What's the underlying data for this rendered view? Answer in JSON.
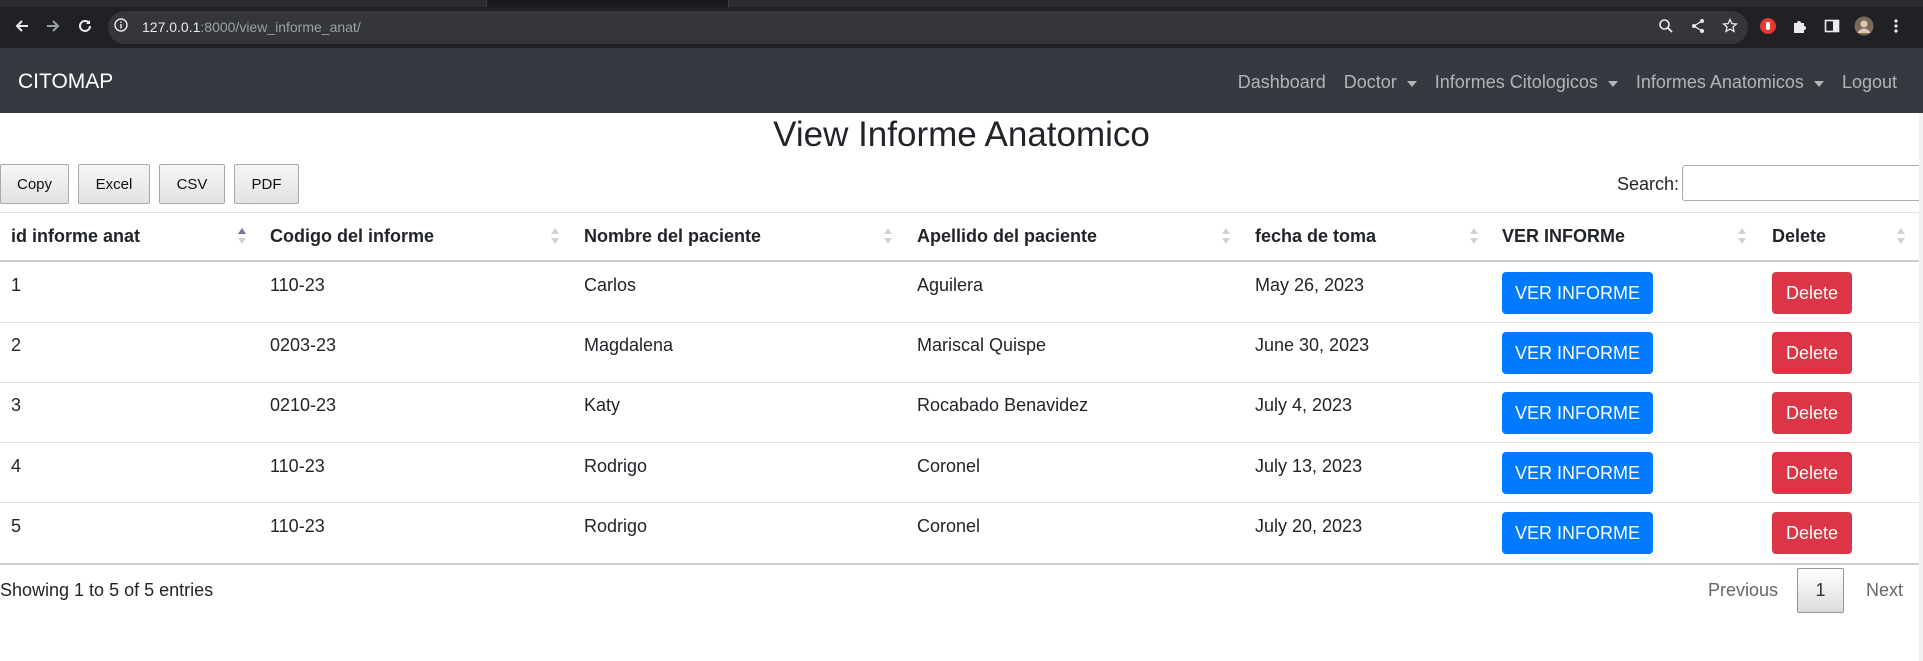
{
  "browser": {
    "url_host": "127.0.0.1",
    "url_path": ":8000/view_informe_anat/"
  },
  "navbar": {
    "brand": "CITOMAP",
    "links": [
      {
        "label": "Dashboard",
        "dropdown": false
      },
      {
        "label": "Doctor",
        "dropdown": true
      },
      {
        "label": "Informes Citologicos",
        "dropdown": true
      },
      {
        "label": "Informes Anatomicos",
        "dropdown": true
      },
      {
        "label": "Logout",
        "dropdown": false
      }
    ]
  },
  "page": {
    "title": "View Informe Anatomico"
  },
  "toolbar": {
    "buttons": [
      "Copy",
      "Excel",
      "CSV",
      "PDF"
    ],
    "search_label": "Search:",
    "search_value": ""
  },
  "table": {
    "headers": [
      "id informe anat",
      "Codigo del informe",
      "Nombre del paciente",
      "Apellido del paciente",
      "fecha de toma",
      "VER INFORMe",
      "Delete"
    ],
    "sorted_column": "id informe anat",
    "rows": [
      {
        "id": "1",
        "codigo": "110-23",
        "nombre": "Carlos",
        "apellido": "Aguilera",
        "fecha": "May 26, 2023",
        "ver": "VER INFORME",
        "delete": "Delete"
      },
      {
        "id": "2",
        "codigo": "0203-23",
        "nombre": "Magdalena",
        "apellido": "Mariscal Quispe",
        "fecha": "June 30, 2023",
        "ver": "VER INFORME",
        "delete": "Delete"
      },
      {
        "id": "3",
        "codigo": "0210-23",
        "nombre": "Katy",
        "apellido": "Rocabado Benavidez",
        "fecha": "July 4, 2023",
        "ver": "VER INFORME",
        "delete": "Delete"
      },
      {
        "id": "4",
        "codigo": "110-23",
        "nombre": "Rodrigo",
        "apellido": "Coronel",
        "fecha": "July 13, 2023",
        "ver": "VER INFORME",
        "delete": "Delete"
      },
      {
        "id": "5",
        "codigo": "110-23",
        "nombre": "Rodrigo",
        "apellido": "Coronel",
        "fecha": "July 20, 2023",
        "ver": "VER INFORME",
        "delete": "Delete"
      }
    ]
  },
  "footer": {
    "info": "Showing 1 to 5 of 5 entries",
    "previous": "Previous",
    "current_page": "1",
    "next": "Next"
  },
  "colors": {
    "navbar_bg": "#343a40",
    "primary": "#007bff",
    "danger": "#dc3545"
  }
}
